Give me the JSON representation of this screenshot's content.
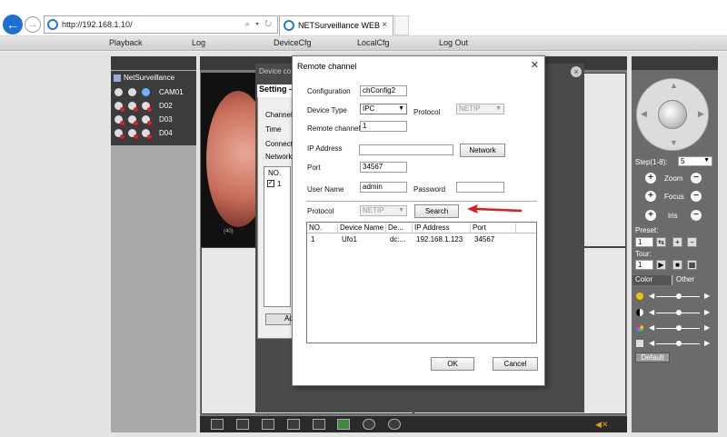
{
  "browser": {
    "url": "http://192.168.1.10/",
    "url_controls": "⌕ ▾ ↻",
    "tab_title": "NETSurveillance WEB",
    "tab_close": "×"
  },
  "menu": {
    "items": [
      "Playback",
      "Log",
      "DeviceCfg",
      "LocalCfg",
      "Log Out"
    ]
  },
  "device_tree": {
    "root": "NetSurveillance",
    "channels": [
      "CAM01",
      "D02",
      "D03",
      "D04"
    ]
  },
  "video": {
    "timestamp": "(40)"
  },
  "device_config": {
    "title": "Device co",
    "setting_title": "Setting -",
    "labels": [
      "Channel",
      "Time",
      "Connect",
      "Network"
    ],
    "list_header": "NO.",
    "list_row": "1",
    "add_label": "Ad",
    "close": "×"
  },
  "remote_channel": {
    "title": "Remote channel",
    "close": "✕",
    "configuration_label": "Configuration",
    "configuration_value": "chConfig2",
    "device_type_label": "Device Type",
    "device_type_value": "IPC",
    "protocol_label": "Protocol",
    "protocol_value": "NETIP",
    "remote_channel_label": "Remote channel",
    "remote_channel_value": "1",
    "ip_label": "IP Address",
    "ip_value": "",
    "network_button": "Network",
    "port_label": "Port",
    "port_value": "34567",
    "username_label": "User Name",
    "username_value": "admin",
    "password_label": "Password",
    "password_value": "",
    "search_protocol_label": "Protocol",
    "search_protocol_value": "NETIP",
    "search_button": "Search",
    "ok_button": "OK",
    "cancel_button": "Cancel",
    "table": {
      "headers": [
        "NO.",
        "Device Name",
        "De...",
        "IP Address",
        "Port"
      ],
      "rows": [
        [
          "1",
          "Ufo1",
          "dc:...",
          "192.168.1.123",
          "34567"
        ]
      ]
    }
  },
  "ptz": {
    "step_label": "Step(1-8):",
    "step_value": "5",
    "zoom_label": "Zoom",
    "focus_label": "Focus",
    "iris_label": "Iris",
    "preset_label": "Preset:",
    "preset_value": "1",
    "tour_label": "Tour:",
    "tour_value": "1",
    "color_tab": "Color",
    "other_tab": "Other",
    "default_button": "Default",
    "plus": "+",
    "minus": "−"
  },
  "colors": {
    "accent": "#1d6fd0",
    "annotation_arrow": "#d61f1f"
  }
}
